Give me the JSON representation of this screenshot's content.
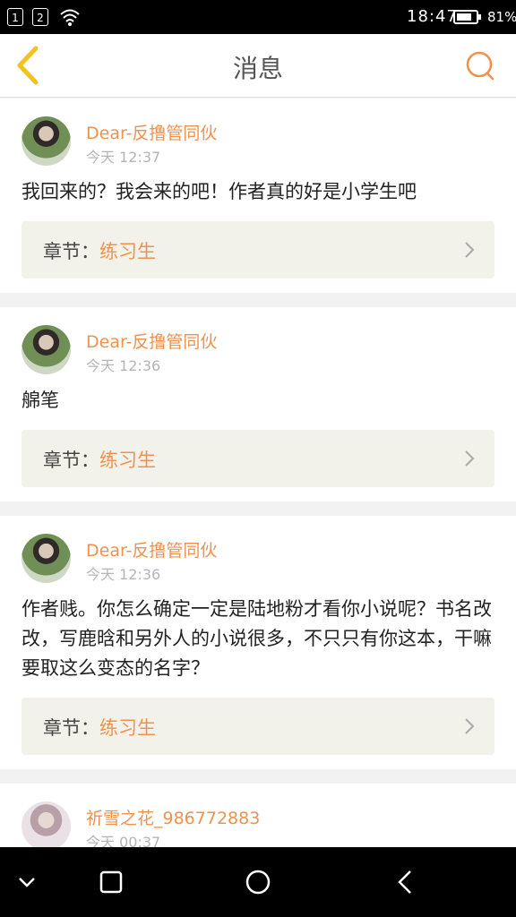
{
  "status_bar": {
    "sim1": "1",
    "sim2": "2",
    "time": "18:47",
    "battery_pct": "81%",
    "battery_level": 0.81
  },
  "header": {
    "title": "消息",
    "back_icon": "back-chevron-icon",
    "search_icon": "search-icon"
  },
  "messages": [
    {
      "user": "Dear-反撸管同伙",
      "time": "今天 12:37",
      "content": "我回来的？我会来的吧！作者真的好是小学生吧",
      "chapter_label": "章节：",
      "chapter_name": "练习生"
    },
    {
      "user": "Dear-反撸管同伙",
      "time": "今天 12:36",
      "content": "艊笔",
      "chapter_label": "章节：",
      "chapter_name": "练习生"
    },
    {
      "user": "Dear-反撸管同伙",
      "time": "今天 12:36",
      "content": "作者贱。你怎么确定一定是陆地粉才看你小说呢？书名改改，写鹿晗和另外人的小说很多，不只只有你这本，干嘛要取这么变态的名字？",
      "chapter_label": "章节：",
      "chapter_name": "练习生"
    },
    {
      "user": "祈雪之花_986772883",
      "time": "今天 00:37"
    }
  ],
  "nav": {
    "icons": [
      "collapse-icon",
      "recent-apps-icon",
      "home-icon",
      "back-icon"
    ]
  },
  "colors": {
    "accent": "#f0924e",
    "back_icon": "#f2c320",
    "chapter_bg": "#f2f2ea"
  }
}
